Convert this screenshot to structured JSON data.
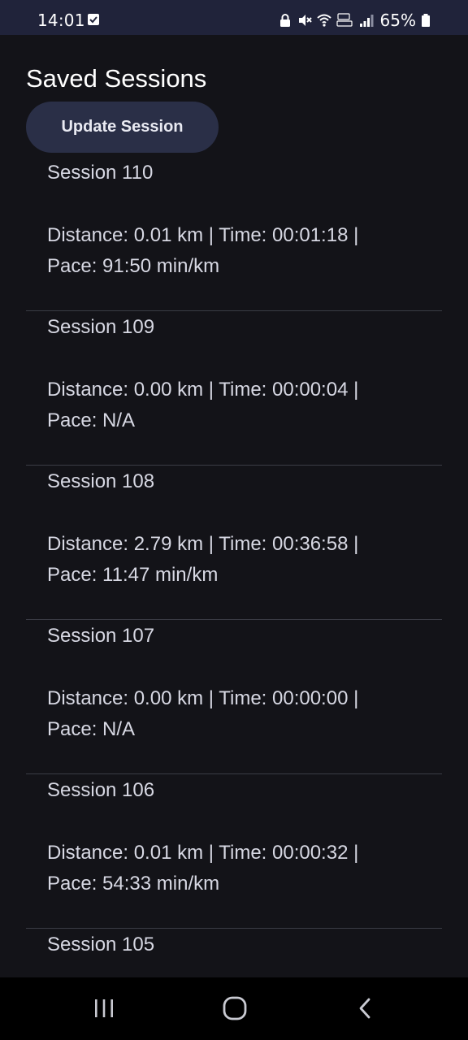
{
  "status_bar": {
    "time": "14:01",
    "battery_percent": "65%",
    "icons": [
      "check-square-icon",
      "lock-icon",
      "mute-icon",
      "wifi-icon",
      "volte-icon",
      "signal-icon",
      "battery-icon"
    ]
  },
  "page": {
    "title": "Saved Sessions",
    "update_button_label": "Update Session"
  },
  "sessions": [
    {
      "title": "Session 110",
      "details": "Distance: 0.01 km | Time: 00:01:18 | Pace: 91:50 min/km"
    },
    {
      "title": "Session 109",
      "details": "Distance: 0.00 km | Time: 00:00:04 | Pace: N/A"
    },
    {
      "title": "Session 108",
      "details": "Distance: 2.79 km | Time: 00:36:58 | Pace: 11:47 min/km"
    },
    {
      "title": "Session 107",
      "details": "Distance: 0.00 km | Time: 00:00:00 | Pace: N/A"
    },
    {
      "title": "Session 106",
      "details": "Distance: 0.01 km | Time: 00:00:32 | Pace: 54:33 min/km"
    },
    {
      "title": "Session 105",
      "details": ""
    }
  ],
  "nav_bar": {
    "icons": [
      "recent-apps-icon",
      "home-icon",
      "back-icon"
    ]
  },
  "colors": {
    "background": "#131318",
    "status_bar": "#20233a",
    "button": "#2a2f47",
    "text": "#d7d8e3"
  }
}
